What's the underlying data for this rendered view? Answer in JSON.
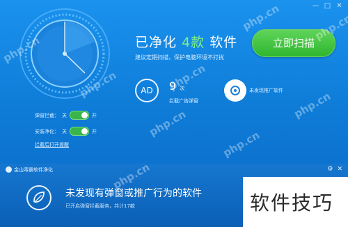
{
  "window": {
    "controls": [
      "—",
      "□",
      "✕"
    ]
  },
  "main": {
    "headline_prefix": "已净化",
    "headline_count": "4款",
    "headline_suffix": "软件",
    "subline": "建议定期扫描，保护电脑环境不打扰",
    "scan_button": "立即扫描",
    "ad_badge": "AD",
    "ad_count": "9",
    "ad_count_suffix": "次",
    "ad_label": "拦截广告弹窗",
    "unknown_label": "未发现推广软件"
  },
  "toggles": [
    {
      "label": "弹窗拦截：",
      "off": "关",
      "on": "开"
    },
    {
      "label": "安装净化：",
      "off": "关",
      "on": "开"
    }
  ],
  "link": "拦截后打开提醒",
  "popup": {
    "title": "金山毒霸软件净化",
    "controls": [
      "⚙",
      "✕"
    ],
    "message": "未发现有弹窗或推广行为的软件",
    "sub": "已开启弹窗拦截服务，共计17款"
  },
  "tips": "软件技巧",
  "watermarks": [
    "php.cn",
    "php.cn",
    "php.cn",
    "php.cn",
    "php.cn",
    "php.cn",
    "php.cn",
    "php.cn",
    "php.cn"
  ]
}
